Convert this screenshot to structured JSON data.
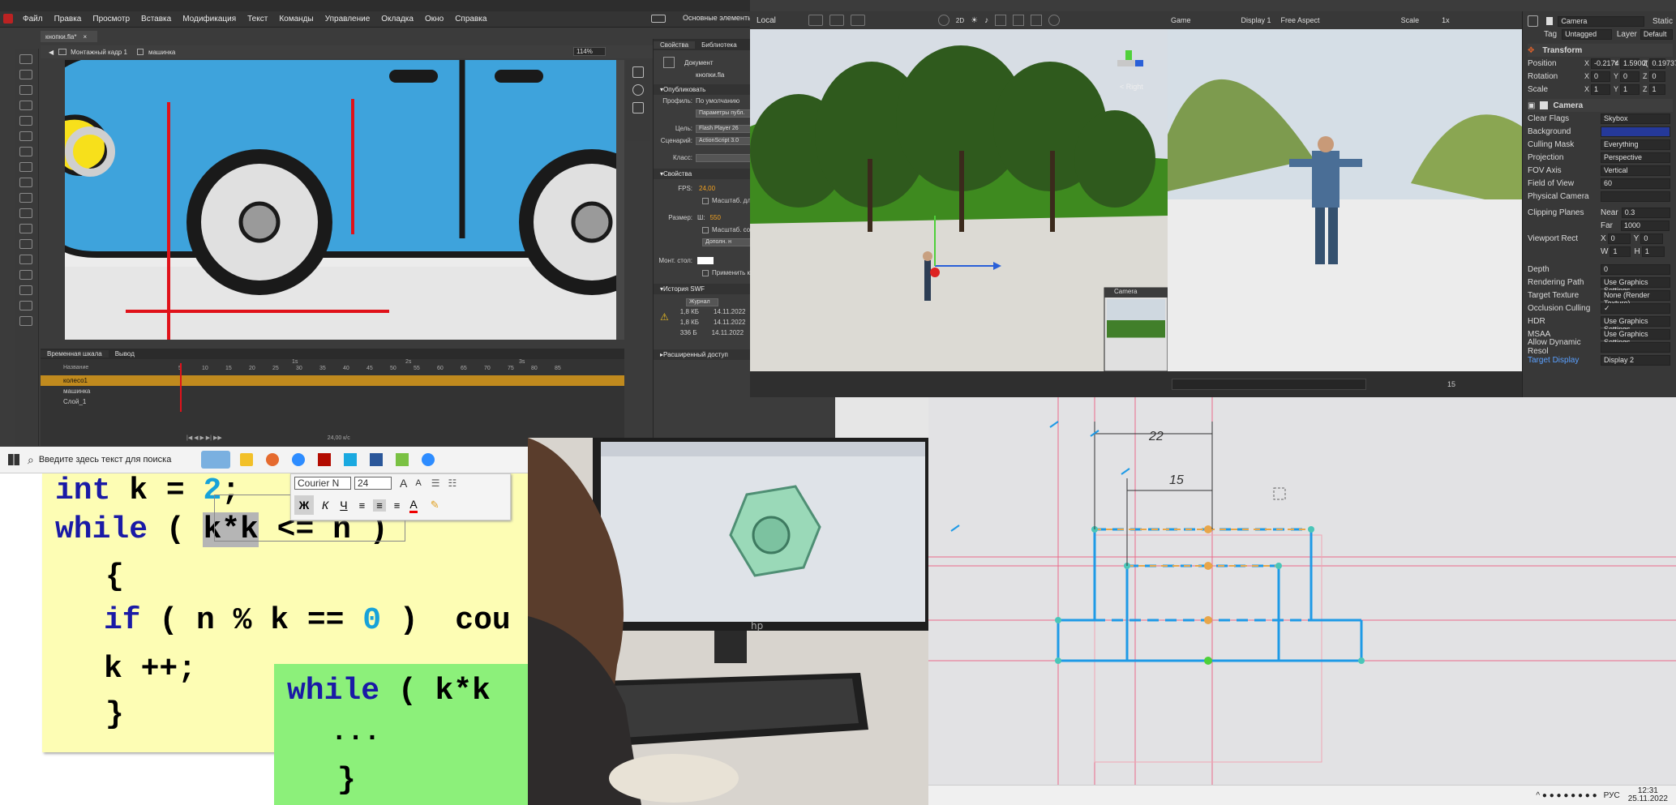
{
  "flash": {
    "app_icon": "flash-logo-icon",
    "menu": [
      "Файл",
      "Правка",
      "Просмотр",
      "Вставка",
      "Модификация",
      "Текст",
      "Команды",
      "Управление",
      "Окладка",
      "Окно",
      "Справка"
    ],
    "workspace": "Основные элементы",
    "doc_tab": "кнопки.fla*",
    "breadcrumb": [
      "Монтажный кадр 1",
      "машинка"
    ],
    "zoom": "114%",
    "props_tabs": [
      "Свойства",
      "Библиотека"
    ],
    "doc_label": "Документ",
    "doc_name": "кнопки.fla",
    "publish_section": "Опубликовать",
    "profile_label": "Профиль:",
    "profile_value": "По умолчанию",
    "publish_params": "Параметры публ.",
    "target_label": "Цель:",
    "target_value": "Flash Player 26",
    "script_label": "Сценарий:",
    "script_value": "ActionScript 3.0",
    "class_label": "Класс:",
    "properties_section": "Свойства",
    "fps_label": "FPS:",
    "fps_value": "24,00",
    "scale_check": "Масштаб. дл",
    "size_label": "Размер:",
    "size_w_label": "Ш:",
    "size_w_value": "550",
    "scale_check2": "Масштаб. со",
    "more_button": "Дополн. н",
    "stage_label": "Монт. стол:",
    "apply_check": "Применить к",
    "swf_section": "История SWF",
    "log_button": "Журнал",
    "swf_history": [
      {
        "size": "1,8 КБ",
        "date": "14.11.2022"
      },
      {
        "size": "1,8 КБ",
        "date": "14.11.2022"
      },
      {
        "size": "336 Б",
        "date": "14.11.2022"
      }
    ],
    "accessibility_section": "Расширенный доступ",
    "timeline_tabs": [
      "Временная шкала",
      "Вывод"
    ],
    "layers": [
      "колесо1",
      "машинка",
      "Слой_1"
    ],
    "frame_numbers": [
      "5",
      "10",
      "15",
      "20",
      "25",
      "30",
      "35",
      "40",
      "45",
      "50",
      "55",
      "60",
      "65",
      "70",
      "75",
      "80",
      "85"
    ],
    "seconds": [
      "1s",
      "2s",
      "3s"
    ],
    "layer_name_field": "Название",
    "fps_readout": "24,00 к/с"
  },
  "taskbar": {
    "start_icon": "windows-start-icon",
    "search_placeholder": "Введите здесь текст для поиска"
  },
  "code": {
    "line1_kw": "int",
    "line1_rest": " k = ",
    "line1_num": "2",
    "line1_end": ";",
    "line2_kw": "while",
    "line2_open": " ( ",
    "line2_sel": "k*k",
    "line2_rest": " <= n ",
    "line2_close": ")",
    "brace_open": "{",
    "line4_kw": "if",
    "line4_a": " ( n % k == ",
    "line4_num": "0",
    "line4_b": " )  cou",
    "line5": "k ++;",
    "brace_close": "}",
    "box_kw": "while",
    "box_rest": " ( k*k",
    "box_dots": "...",
    "box_close": "}",
    "font_name": "Courier N",
    "font_size": "24",
    "fmt_bold": "Ж",
    "fmt_italic": "К",
    "fmt_underline": "Ч",
    "font_grow": "A",
    "font_shrink": "A"
  },
  "unity": {
    "pivot": "Local",
    "game_tab": "Game",
    "display": "Display 1",
    "aspect": "Free Aspect",
    "scale_label": "Scale",
    "scale_value": "1x",
    "gizmo_label": "< Right",
    "camera_preview": "Camera",
    "scene_count": "15",
    "object_name": "Camera",
    "static_label": "Static",
    "tag_label": "Tag",
    "tag_value": "Untagged",
    "layer_label": "Layer",
    "layer_value": "Default",
    "transform": "Transform",
    "position_label": "Position",
    "position": {
      "x": "-0.2174",
      "y": "1.5900(",
      "z": "0.19737"
    },
    "rotation_label": "Rotation",
    "rotation": {
      "x": "0",
      "y": "0",
      "z": "0"
    },
    "scale_row_label": "Scale",
    "scale": {
      "x": "1",
      "y": "1",
      "z": "1"
    },
    "camera_component": "Camera",
    "props": [
      {
        "label": "Clear Flags",
        "value": "Skybox"
      },
      {
        "label": "Background",
        "value": ""
      },
      {
        "label": "Culling Mask",
        "value": "Everything"
      },
      {
        "label": "Projection",
        "value": "Perspective"
      },
      {
        "label": "FOV Axis",
        "value": "Vertical"
      },
      {
        "label": "Field of View",
        "value": "60"
      },
      {
        "label": "Physical Camera",
        "value": ""
      }
    ],
    "clipping_label": "Clipping Planes",
    "near_label": "Near",
    "near_value": "0.3",
    "far_label": "Far",
    "far_value": "1000",
    "viewport_label": "Viewport Rect",
    "vp": {
      "x": "0",
      "y": "0",
      "w": "1",
      "h": "1"
    },
    "props2": [
      {
        "label": "Depth",
        "value": "0"
      },
      {
        "label": "Rendering Path",
        "value": "Use Graphics Settings"
      },
      {
        "label": "Target Texture",
        "value": "None (Render Texture)"
      },
      {
        "label": "Occlusion Culling",
        "value": "✓"
      },
      {
        "label": "HDR",
        "value": "Use Graphics Settings"
      },
      {
        "label": "MSAA",
        "value": "Use Graphics Settings"
      },
      {
        "label": "Allow Dynamic Resol",
        "value": ""
      },
      {
        "label": "Target Display",
        "value": "Display 2"
      }
    ]
  },
  "cad": {
    "dim1": "22",
    "dim2": "15",
    "tray_lang": "РУС",
    "time": "12:31",
    "date": "25.11.2022"
  },
  "monitor_brand": "hp",
  "colors": {
    "unity_bg": "#3c3c3c",
    "flash_bg": "#3b3b3b",
    "code_yellow": "#fdfdb4",
    "code_green": "#8cf07a",
    "cad_bg": "#e2e2e4",
    "cad_blue": "#1e9ae6"
  }
}
